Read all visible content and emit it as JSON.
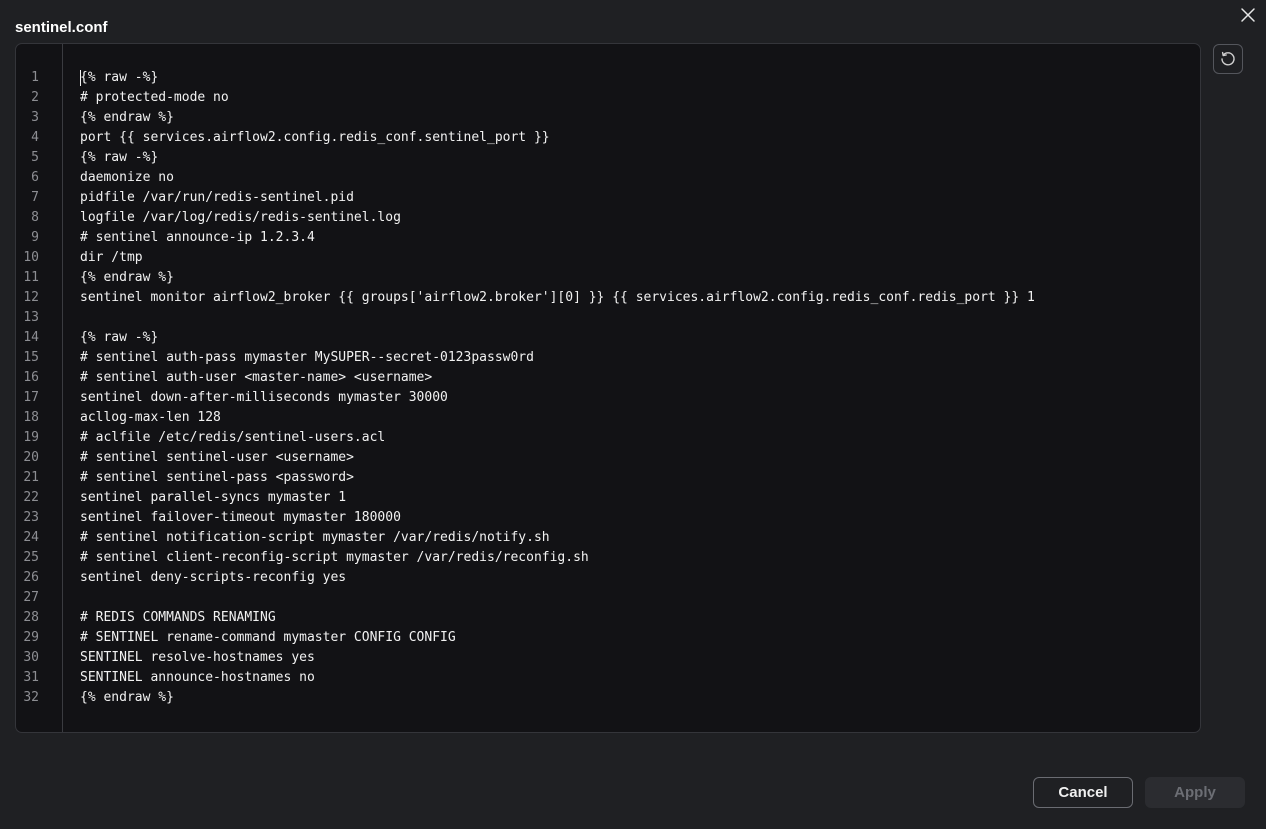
{
  "dialog": {
    "title": "sentinel.conf",
    "close_icon": "close-icon",
    "reset_icon": "reset-icon"
  },
  "editor": {
    "line_numbers": [
      "1",
      "2",
      "3",
      "4",
      "5",
      "6",
      "7",
      "8",
      "9",
      "10",
      "11",
      "12",
      "13",
      "14",
      "15",
      "16",
      "17",
      "18",
      "19",
      "20",
      "21",
      "22",
      "23",
      "24",
      "25",
      "26",
      "27",
      "28",
      "29",
      "30",
      "31",
      "32"
    ],
    "lines": [
      "{% raw -%}",
      "# protected-mode no",
      "{% endraw %}",
      "port {{ services.airflow2.config.redis_conf.sentinel_port }}",
      "{% raw -%}",
      "daemonize no",
      "pidfile /var/run/redis-sentinel.pid",
      "logfile /var/log/redis/redis-sentinel.log",
      "# sentinel announce-ip 1.2.3.4",
      "dir /tmp",
      "{% endraw %}",
      "sentinel monitor airflow2_broker {{ groups['airflow2.broker'][0] }} {{ services.airflow2.config.redis_conf.redis_port }} 1",
      "",
      "{% raw -%}",
      "# sentinel auth-pass mymaster MySUPER--secret-0123passw0rd",
      "# sentinel auth-user <master-name> <username>",
      "sentinel down-after-milliseconds mymaster 30000",
      "acllog-max-len 128",
      "# aclfile /etc/redis/sentinel-users.acl",
      "# sentinel sentinel-user <username>",
      "# sentinel sentinel-pass <password>",
      "sentinel parallel-syncs mymaster 1",
      "sentinel failover-timeout mymaster 180000",
      "# sentinel notification-script mymaster /var/redis/notify.sh",
      "# sentinel client-reconfig-script mymaster /var/redis/reconfig.sh",
      "sentinel deny-scripts-reconfig yes",
      "",
      "# REDIS COMMANDS RENAMING",
      "# SENTINEL rename-command mymaster CONFIG CONFIG",
      "SENTINEL resolve-hostnames yes",
      "SENTINEL announce-hostnames no",
      "{% endraw %}"
    ]
  },
  "footer": {
    "cancel_label": "Cancel",
    "apply_label": "Apply"
  },
  "colors": {
    "background": "#1f2023",
    "editor_background": "#121215",
    "text": "#f2f2f2",
    "line_number": "#8d8e93",
    "apply_disabled_text": "#6c6e74"
  }
}
